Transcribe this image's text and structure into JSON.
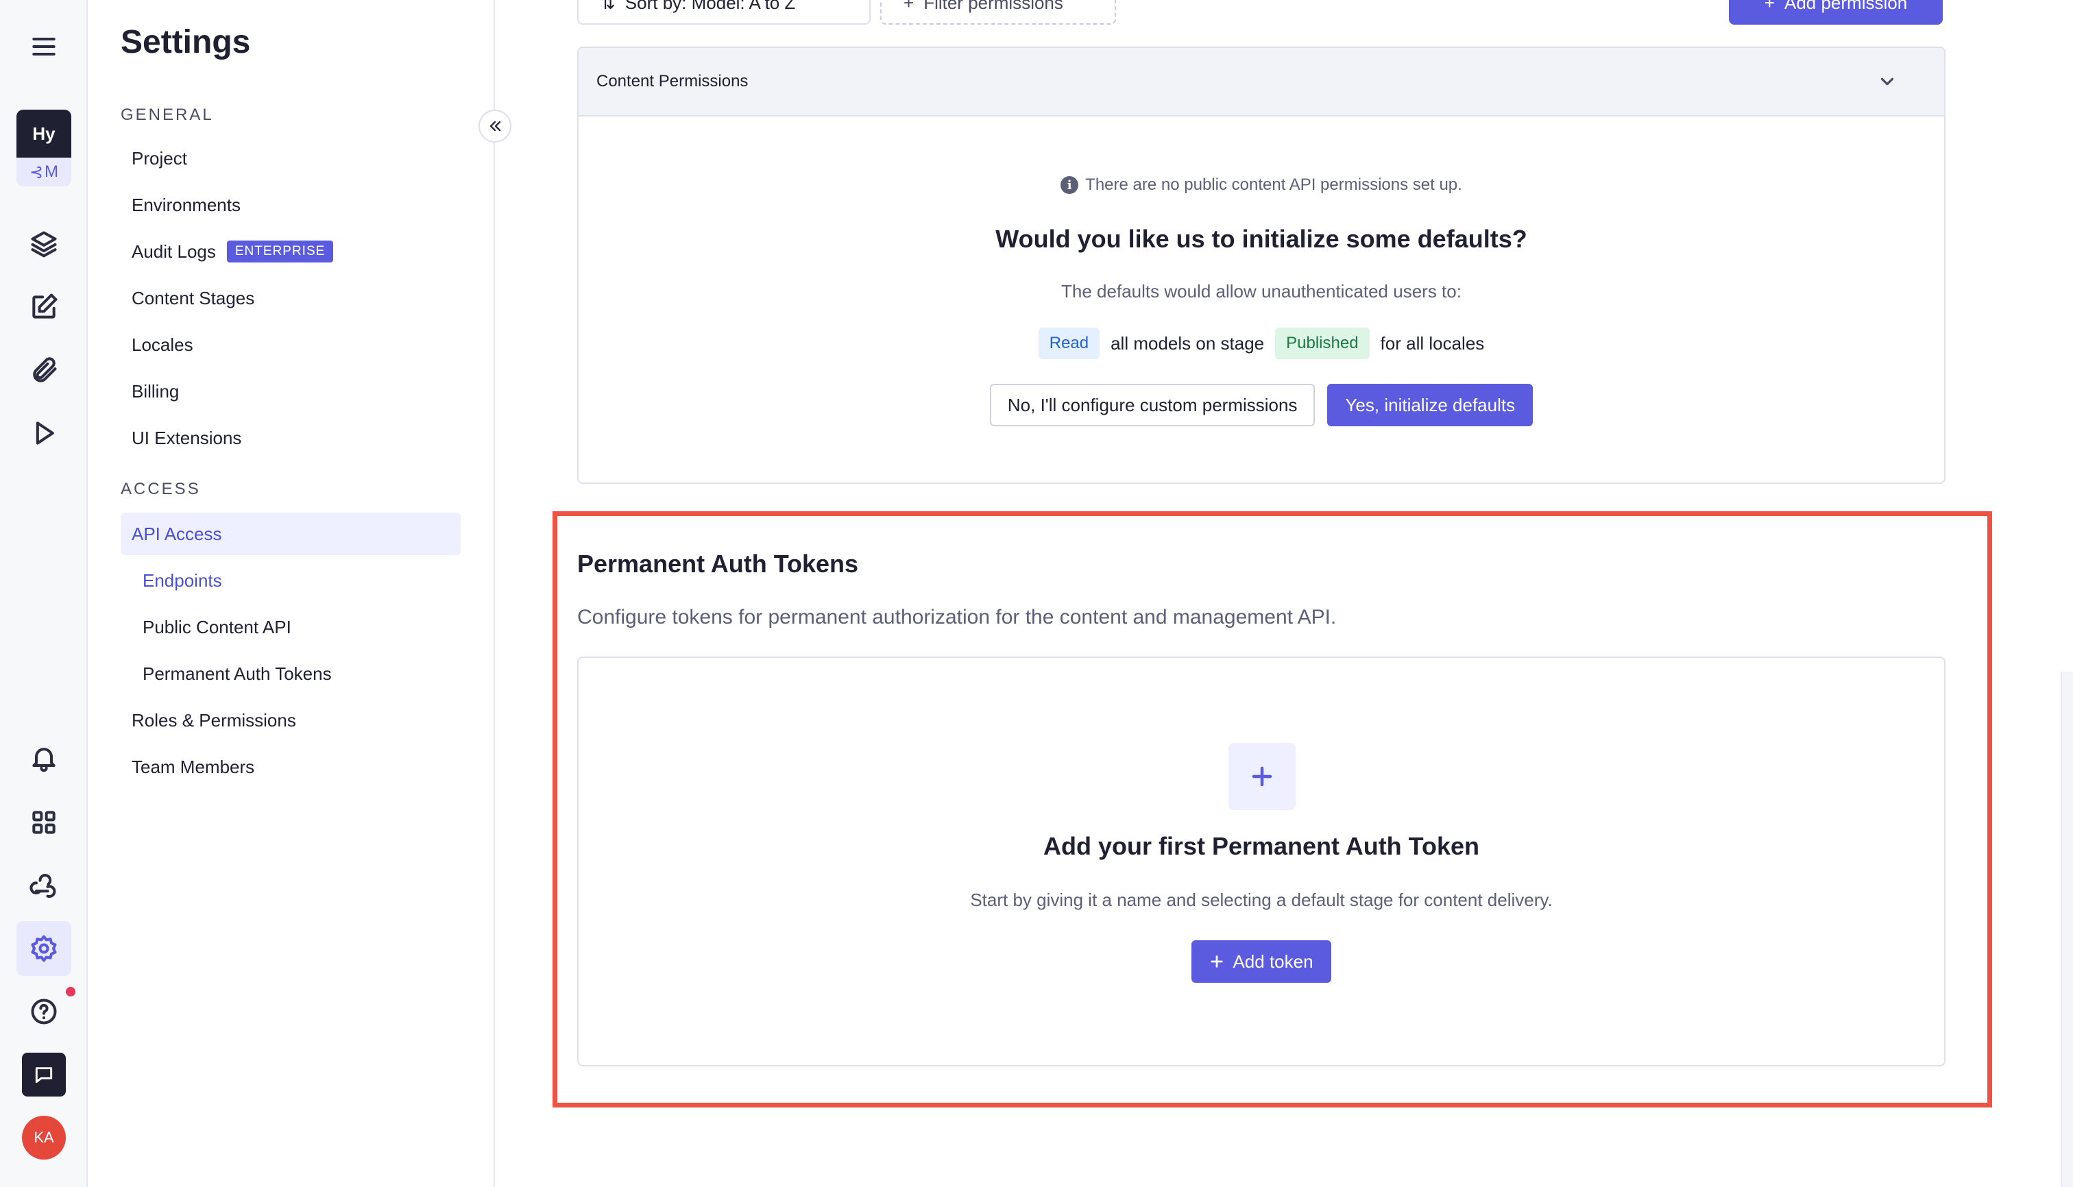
{
  "rail": {
    "project_initials": "Hy",
    "project_env": "M",
    "user_initials": "KA"
  },
  "sidebar": {
    "title": "Settings",
    "general_title": "GENERAL",
    "general_items": [
      {
        "label": "Project"
      },
      {
        "label": "Environments"
      },
      {
        "label": "Audit Logs",
        "badge": "ENTERPRISE"
      },
      {
        "label": "Content Stages"
      },
      {
        "label": "Locales"
      },
      {
        "label": "Billing"
      },
      {
        "label": "UI Extensions"
      }
    ],
    "access_title": "ACCESS",
    "access_items": [
      {
        "label": "API Access",
        "active": true
      },
      {
        "label": "Endpoints",
        "sub": true
      },
      {
        "label": "Public Content API",
        "sub": true
      },
      {
        "label": "Permanent Auth Tokens",
        "sub": true
      },
      {
        "label": "Roles & Permissions"
      },
      {
        "label": "Team Members"
      }
    ]
  },
  "toolbar": {
    "sort_label": "Sort by: Model: A to Z",
    "filter_label": "Filter permissions",
    "add_permission_label": "Add permission"
  },
  "content_permissions": {
    "header": "Content Permissions",
    "info": "There are no public content API permissions set up.",
    "question": "Would you like us to initialize some defaults?",
    "defaults_desc": "The defaults would allow unauthenticated users to:",
    "read_pill": "Read",
    "models_text": "all models on stage",
    "stage_pill": "Published",
    "locales_text": "for all locales",
    "custom_button": "No, I'll configure custom permissions",
    "init_button": "Yes, initialize defaults"
  },
  "tokens": {
    "title": "Permanent Auth Tokens",
    "description": "Configure tokens for permanent authorization for the content and management API.",
    "empty_title": "Add your first Permanent Auth Token",
    "empty_desc": "Start by giving it a name and selecting a default stage for content delivery.",
    "add_button": "Add token"
  },
  "colors": {
    "accent": "#5b5be0",
    "highlight_border": "#ee5244",
    "notification_dot": "#e8385a"
  }
}
